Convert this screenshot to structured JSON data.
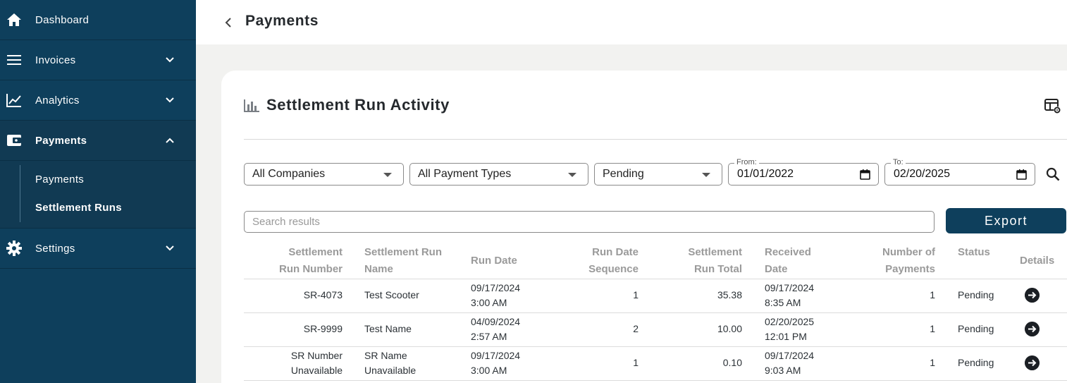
{
  "sidebar": {
    "items": [
      {
        "label": "Dashboard",
        "icon": "home-icon"
      },
      {
        "label": "Invoices",
        "icon": "menu-icon"
      },
      {
        "label": "Analytics",
        "icon": "trending-icon"
      },
      {
        "label": "Payments",
        "icon": "wallet-icon"
      },
      {
        "label": "Settings",
        "icon": "gear-icon"
      }
    ],
    "payments_submenu": [
      {
        "label": "Payments"
      },
      {
        "label": "Settlement Runs"
      }
    ]
  },
  "header": {
    "title": "Payments"
  },
  "card": {
    "title": "Settlement Run Activity"
  },
  "filters": {
    "company": "All Companies",
    "payment_type": "All Payment Types",
    "status": "Pending",
    "from_label": "From:",
    "from_value": "01/01/2022",
    "to_label": "To:",
    "to_value": "02/20/2025"
  },
  "search": {
    "placeholder": "Search results"
  },
  "export_label": "Export",
  "table": {
    "columns": [
      {
        "line1": "Settlement",
        "line2": "Run Number"
      },
      {
        "line1": "Settlement Run",
        "line2": "Name"
      },
      {
        "line1": "Run Date",
        "line2": ""
      },
      {
        "line1": "Run Date",
        "line2": "Sequence"
      },
      {
        "line1": "Settlement",
        "line2": "Run Total"
      },
      {
        "line1": "Received",
        "line2": "Date"
      },
      {
        "line1": "Number of",
        "line2": "Payments"
      },
      {
        "line1": "Status",
        "line2": ""
      },
      {
        "line1": "Details",
        "line2": ""
      }
    ],
    "rows": [
      {
        "number": [
          "SR-4073",
          ""
        ],
        "name": [
          "Test Scooter",
          ""
        ],
        "run_date": [
          "09/17/2024",
          "3:00 AM"
        ],
        "sequence": "1",
        "total": "35.38",
        "received": [
          "09/17/2024",
          "8:35 AM"
        ],
        "payments": "1",
        "status": "Pending"
      },
      {
        "number": [
          "SR-9999",
          ""
        ],
        "name": [
          "Test Name",
          ""
        ],
        "run_date": [
          "04/09/2024",
          "2:57 AM"
        ],
        "sequence": "2",
        "total": "10.00",
        "received": [
          "02/20/2025",
          "12:01 PM"
        ],
        "payments": "1",
        "status": "Pending"
      },
      {
        "number": [
          "SR Number",
          "Unavailable"
        ],
        "name": [
          "SR Name",
          "Unavailable"
        ],
        "run_date": [
          "09/17/2024",
          "3:00 AM"
        ],
        "sequence": "1",
        "total": "0.10",
        "received": [
          "09/17/2024",
          "9:03 AM"
        ],
        "payments": "1",
        "status": "Pending"
      }
    ]
  },
  "colors": {
    "sidebar": "#0e3f5c",
    "accent": "#0e3f5c"
  }
}
